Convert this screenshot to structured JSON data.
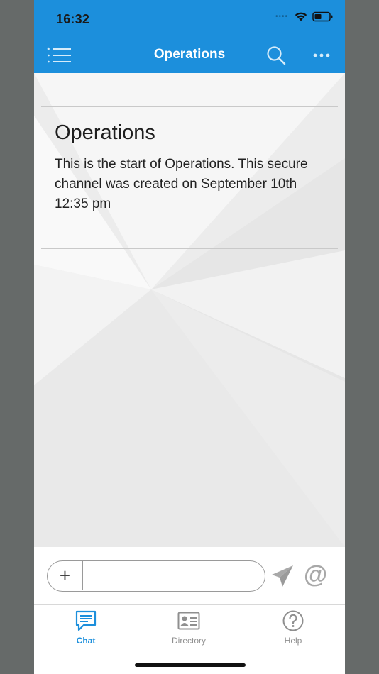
{
  "status_bar": {
    "time": "16:32"
  },
  "header": {
    "title": "Operations"
  },
  "channel": {
    "title": "Operations",
    "description": "This is the start of Operations. This secure channel was created on September 10th 12:35 pm"
  },
  "composer": {
    "add_label": "+",
    "message_placeholder": "",
    "mention_label": "@"
  },
  "tabs": [
    {
      "label": "Chat",
      "active": true
    },
    {
      "label": "Directory",
      "active": false
    },
    {
      "label": "Help",
      "active": false
    }
  ],
  "colors": {
    "accent": "#1c8fdc",
    "inactive": "#8f8f8f",
    "background": "#efefef"
  },
  "icons": [
    "menu-icon",
    "search-icon",
    "more-icon",
    "wifi-icon",
    "battery-icon",
    "send-icon",
    "chat-icon",
    "directory-icon",
    "help-icon"
  ]
}
